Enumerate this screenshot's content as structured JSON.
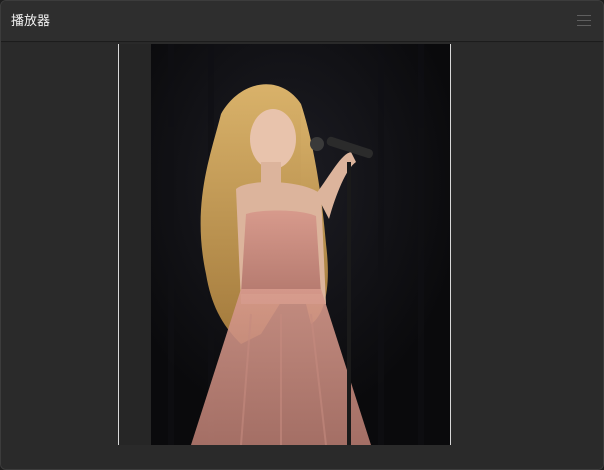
{
  "window": {
    "title": "播放器"
  },
  "toolbar": {
    "menu_icon": "hamburger-menu-icon"
  },
  "video": {
    "subject": "singer-with-microphone"
  },
  "colors": {
    "window_bg": "#292929",
    "titlebar_bg": "#2e2e2e",
    "title_text": "#f2f2f2",
    "frame_border": "#d8d8d8"
  }
}
